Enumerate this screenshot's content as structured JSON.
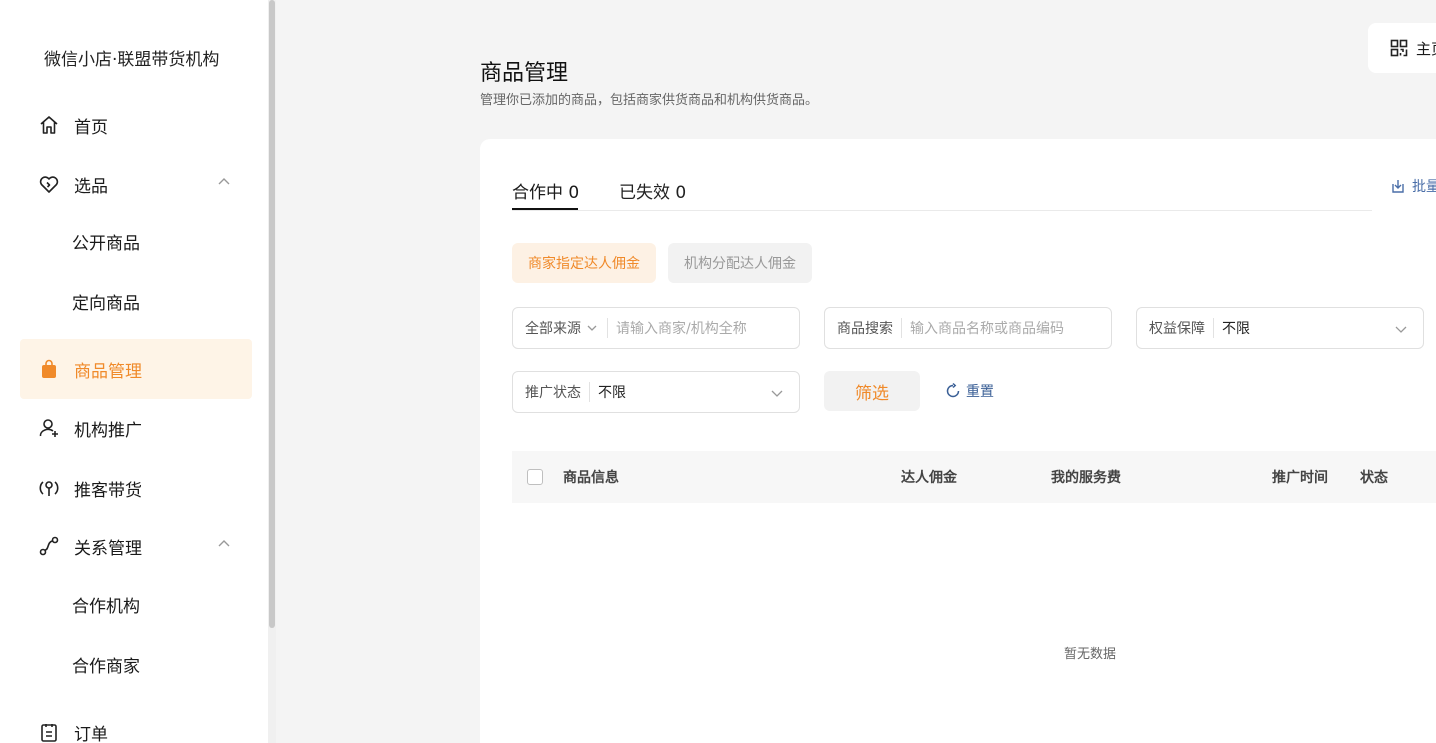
{
  "sidebar": {
    "brand": "微信小店·联盟带货机构",
    "items": [
      {
        "label": "首页"
      },
      {
        "label": "选品"
      },
      {
        "label": "公开商品"
      },
      {
        "label": "定向商品"
      },
      {
        "label": "商品管理"
      },
      {
        "label": "机构推广"
      },
      {
        "label": "推客带货"
      },
      {
        "label": "关系管理"
      },
      {
        "label": "合作机构"
      },
      {
        "label": "合作商家"
      },
      {
        "label": "订单"
      }
    ]
  },
  "topbar": {
    "home_label": "主页"
  },
  "header": {
    "title": "商品管理",
    "subtitle": "管理你已添加的商品，包括商家供货商品和机构供货商品。"
  },
  "tabs": [
    {
      "label": "合作中 0"
    },
    {
      "label": "已失效 0"
    }
  ],
  "batch_label": "批量",
  "segments": {
    "merchant": "商家指定达人佣金",
    "agency": "机构分配达人佣金"
  },
  "filters": {
    "source": {
      "label": "全部来源",
      "placeholder": "请输入商家/机构全称"
    },
    "search": {
      "label": "商品搜索",
      "placeholder": "输入商品名称或商品编码"
    },
    "benefit": {
      "label": "权益保障",
      "value": "不限"
    },
    "status": {
      "label": "推广状态",
      "value": "不限"
    },
    "filter_button": "筛选",
    "reset_button": "重置"
  },
  "table": {
    "columns": [
      "商品信息",
      "达人佣金",
      "我的服务费",
      "推广时间",
      "状态"
    ],
    "empty_text": "暂无数据"
  },
  "colors": {
    "accent": "#f08a2a",
    "accent_bg": "#fef4e7",
    "link": "#3a5f96"
  }
}
